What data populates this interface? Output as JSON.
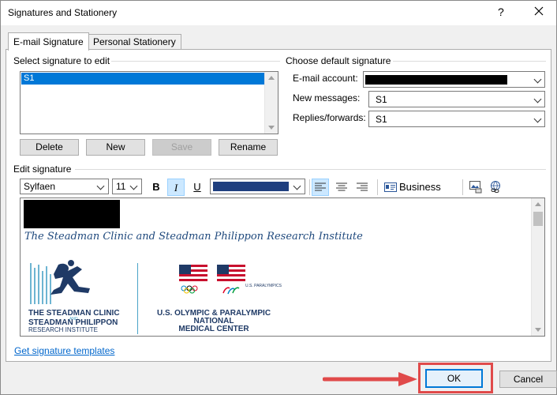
{
  "window": {
    "title": "Signatures and Stationery",
    "help_glyph": "?",
    "close_glyph": "✕"
  },
  "tabs": [
    {
      "label": "E-mail Signature",
      "selected": true
    },
    {
      "label": "Personal Stationery",
      "selected": false
    }
  ],
  "select_section": {
    "heading": "Select signature to edit",
    "items": [
      "S1"
    ],
    "selected": "S1"
  },
  "list_buttons": {
    "delete": "Delete",
    "new": "New",
    "save": "Save",
    "rename": "Rename"
  },
  "default_section": {
    "heading": "Choose default signature",
    "email_account_label": "E-mail account:",
    "new_messages_label": "New messages:",
    "new_messages_value": "S1",
    "replies_label": "Replies/forwards:",
    "replies_value": "S1"
  },
  "edit_section": {
    "heading": "Edit signature",
    "font_name": "Sylfaen",
    "font_size": "11",
    "bold": "B",
    "italic": "I",
    "underline": "U",
    "font_color": "#1f3f7f",
    "business_card": "Business Card"
  },
  "signature_content": {
    "line": "The Steadman Clinic and Steadman Philippon Research Institute",
    "logo_left_line1": "THE STEADMAN CLINIC",
    "logo_left_and": "AND",
    "logo_left_line2": "STEADMAN PHILIPPON",
    "logo_left_line3": "RESEARCH INSTITUTE",
    "logo_right_small": "U.S. PARALYMPICS",
    "logo_right_line1": "U.S. OLYMPIC & PARALYMPIC",
    "logo_right_line2": "NATIONAL",
    "logo_right_line3": "MEDICAL CENTER"
  },
  "footer": {
    "templates_link": "Get signature templates",
    "ok": "OK",
    "cancel": "Cancel"
  },
  "colors": {
    "selection": "#0078d7",
    "link": "#0066cc",
    "highlight": "#e04a4a",
    "signature_text": "#1f497d"
  }
}
